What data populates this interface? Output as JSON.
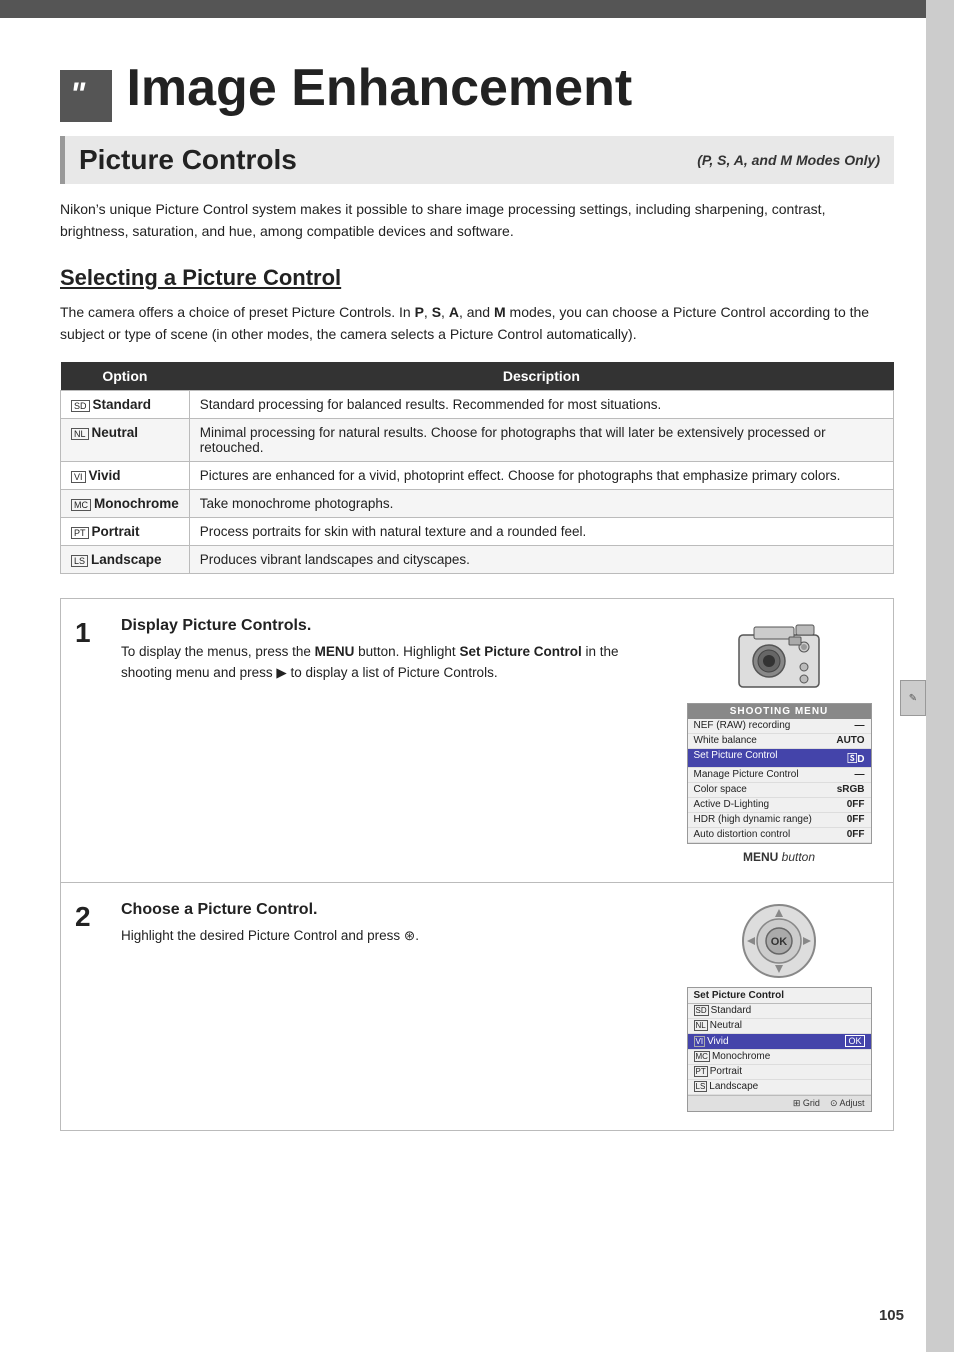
{
  "page": {
    "number": "105",
    "chapter_icon_char": "“",
    "main_title": "Image Enhancement",
    "section_title": "Picture Controls",
    "section_subtitle": "(P, S, A, and M Modes Only)",
    "intro_text": "Nikon’s unique Picture Control system makes it possible to share image processing settings, including sharpening, contrast, brightness, saturation, and hue, among compatible devices and software.",
    "sub_heading": "Selecting a Picture Control",
    "body_text": "The camera offers a choice of preset Picture Controls.  In P, S, A, and M modes, you can choose a Picture Control according to the subject or type of scene (in other modes, the camera selects a Picture Control automatically).",
    "table": {
      "col_option": "Option",
      "col_description": "Description",
      "rows": [
        {
          "icon": "SD",
          "label": "Standard",
          "description": "Standard processing for balanced results.  Recommended for most situations."
        },
        {
          "icon": "NL",
          "label": "Neutral",
          "description": "Minimal processing for natural results.  Choose for photographs that will later be extensively processed or retouched."
        },
        {
          "icon": "VI",
          "label": "Vivid",
          "description": "Pictures are enhanced for a vivid, photoprint effect.  Choose for photographs that emphasize primary colors."
        },
        {
          "icon": "MC",
          "label": "Monochrome",
          "description": "Take monochrome photographs."
        },
        {
          "icon": "PT",
          "label": "Portrait",
          "description": "Process portraits for skin with natural texture and a rounded feel."
        },
        {
          "icon": "LS",
          "label": "Landscape",
          "description": "Produces vibrant landscapes and cityscapes."
        }
      ]
    },
    "steps": [
      {
        "number": "1",
        "title": "Display Picture Controls.",
        "body": "To display the menus, press the MENU button. Highlight Set Picture Control in the shooting menu and press ▶ to display a list of Picture Controls.",
        "image_caption_bold": "MENU",
        "image_caption_rest": " button"
      },
      {
        "number": "2",
        "title": "Choose a Picture Control.",
        "body": "Highlight the desired Picture Control and press Ⓢ.",
        "image_caption": ""
      }
    ],
    "shooting_menu": {
      "title": "SHOOTING MENU",
      "rows": [
        {
          "label": "NEF (RAW) recording",
          "value": "——"
        },
        {
          "label": "White balance",
          "value": "AUTO",
          "bold_val": true
        },
        {
          "label": "Set Picture Control",
          "value": "SD",
          "highlighted": true
        },
        {
          "label": "Manage Picture Control",
          "value": "——"
        },
        {
          "label": "Color space",
          "value": "sRGB"
        },
        {
          "label": "Active D-Lighting",
          "value": "OFF"
        },
        {
          "label": "HDR (high dynamic range)",
          "value": "OFF"
        },
        {
          "label": "Auto distortion control",
          "value": "OFF"
        }
      ]
    },
    "spc_menu": {
      "title": "Set Picture Control",
      "rows": [
        {
          "icon": "SD",
          "label": "Standard",
          "value": ""
        },
        {
          "icon": "NL",
          "label": "Neutral",
          "value": ""
        },
        {
          "icon": "VI",
          "label": "Vivid",
          "value": "OK",
          "highlighted": true
        },
        {
          "icon": "MC",
          "label": "Monochrome",
          "value": ""
        },
        {
          "icon": "PT",
          "label": "Portrait",
          "value": ""
        },
        {
          "icon": "LS",
          "label": "Landscape",
          "value": ""
        }
      ],
      "footer_left": "Grid",
      "footer_right": "Adjust"
    }
  }
}
